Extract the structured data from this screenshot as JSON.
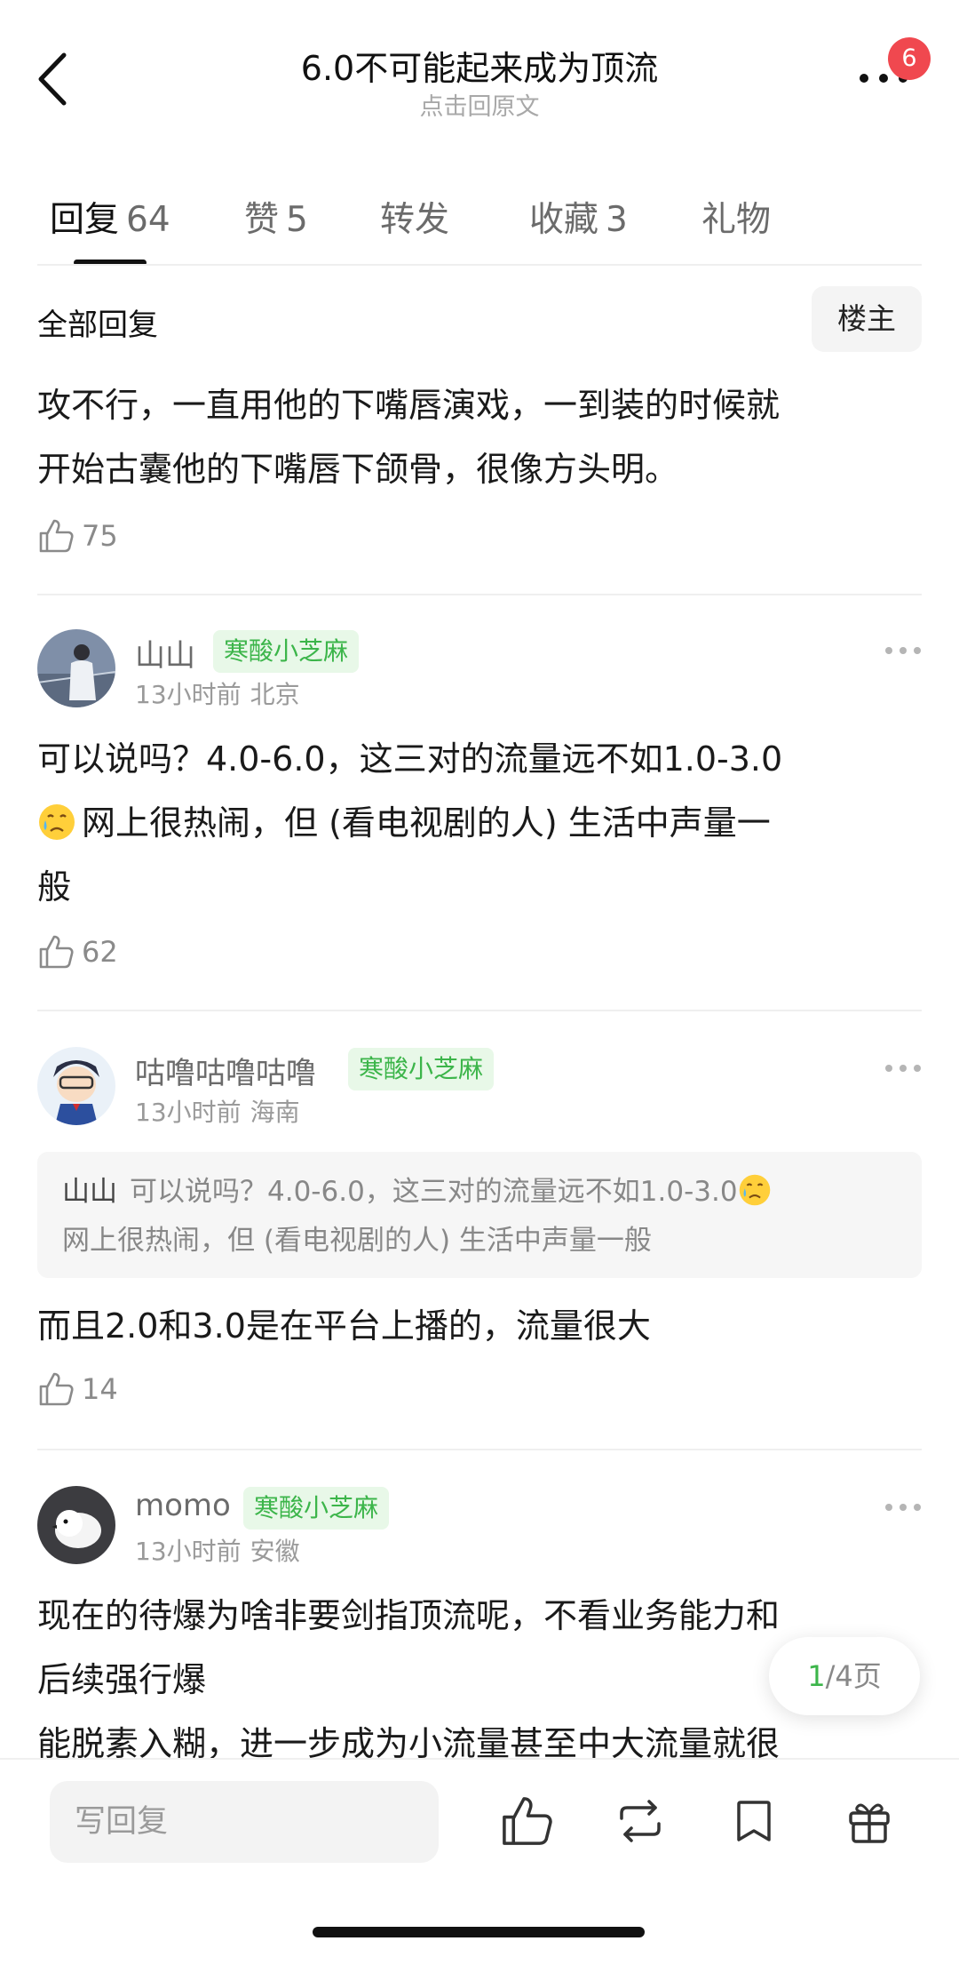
{
  "header": {
    "title": "6.0不可能起来成为顶流",
    "subtitle": "点击回原文",
    "notification_count": "6"
  },
  "tabs": [
    {
      "label": "回复",
      "count": "64",
      "active": true
    },
    {
      "label": "赞",
      "count": "5",
      "active": false
    },
    {
      "label": "转发",
      "count": "",
      "active": false
    },
    {
      "label": "收藏",
      "count": "3",
      "active": false
    },
    {
      "label": "礼物",
      "count": "",
      "active": false
    }
  ],
  "section": {
    "title": "全部回复",
    "owner_filter": "楼主"
  },
  "top_comment": {
    "line1": "攻不行，一直用他的下嘴唇演戏，一到装的时候就",
    "line2": "开始古囊他的下嘴唇下颌骨，很像方头明。",
    "likes": "75"
  },
  "comments": [
    {
      "username": "山山",
      "badge": "寒酸小芝麻",
      "time": "13小时前",
      "location": "北京",
      "line1": "可以说吗？4.0-6.0，这三对的流量远不如1.0-3.0",
      "line2": "网上很热闹，但 (看电视剧的人) 生活中声量一",
      "line3": "般",
      "likes": "62"
    },
    {
      "username": "咕噜咕噜咕噜",
      "badge": "寒酸小芝麻",
      "time": "13小时前",
      "location": "海南",
      "quote_user": "山山",
      "quote_line1": "可以说吗？4.0-6.0，这三对的流量远不如1.0-3.0",
      "quote_line2": "网上很热闹，但 (看电视剧的人) 生活中声量一般",
      "text": "而且2.0和3.0是在平台上播的，流量很大",
      "likes": "14"
    },
    {
      "username": "momo",
      "badge": "寒酸小芝麻",
      "time": "13小时前",
      "location": "安徽",
      "line1": "现在的待爆为啥非要剑指顶流呢，不看业务能力和",
      "line2": "后续强行爆",
      "line3": "能脱素入糊，进一步成为小流量甚至中大流量就很"
    }
  ],
  "pagination": {
    "current": "1",
    "total": "/4页"
  },
  "bottom_bar": {
    "reply_placeholder": "写回复"
  },
  "colors": {
    "accent_green": "#3cb54a",
    "badge_bg": "#e8f8e8",
    "notification_red": "#f0484f"
  },
  "icons": [
    "back-icon",
    "more-icon",
    "like-icon",
    "repost-icon",
    "bookmark-icon",
    "gift-icon",
    "crying-emoji"
  ]
}
